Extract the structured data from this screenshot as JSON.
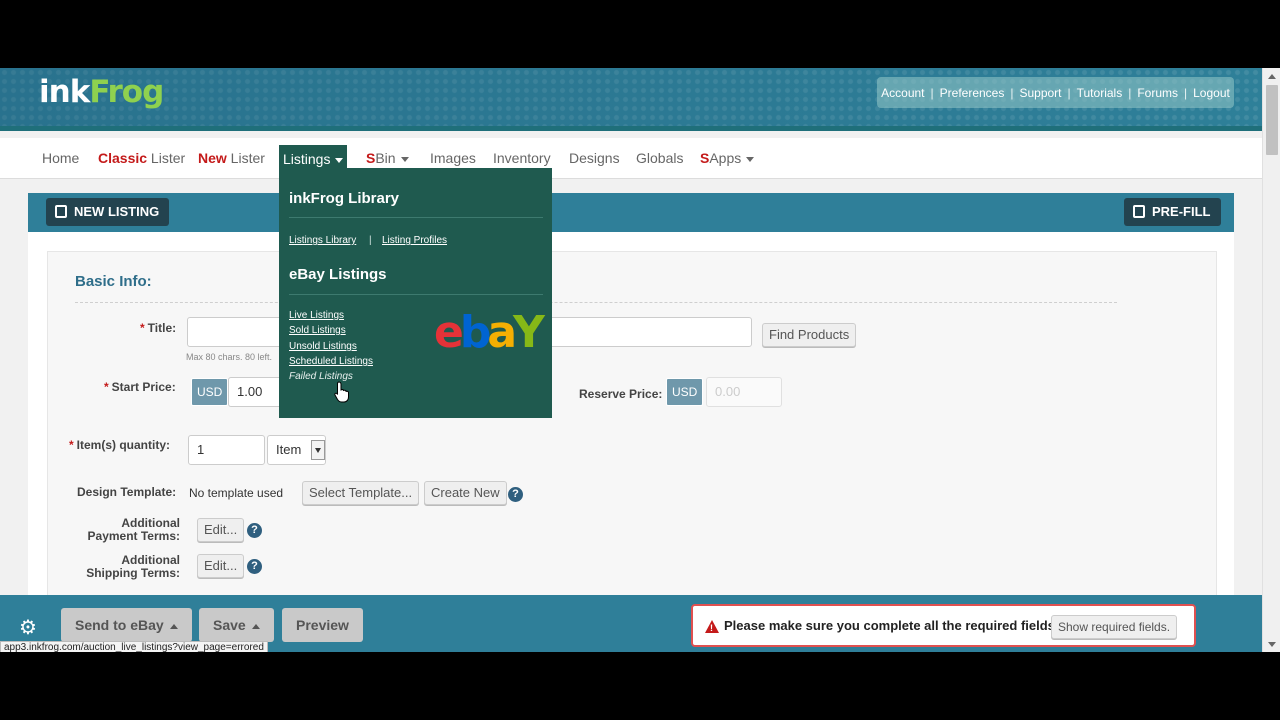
{
  "brand": {
    "logo_ink": "ink",
    "logo_frog": "Frog"
  },
  "account_links": [
    "Account",
    "Preferences",
    "Support",
    "Tutorials",
    "Forums",
    "Logout"
  ],
  "nav": {
    "home": "Home",
    "classic_red": "Classic",
    "classic_rest": " Lister",
    "new_red": "New",
    "new_rest": " Lister",
    "listings": "Listings",
    "sbin_red": "S",
    "sbin_rest": "Bin",
    "images": "Images",
    "inventory": "Inventory",
    "designs": "Designs",
    "globals": "Globals",
    "sapps_red": "S",
    "sapps_rest": "Apps"
  },
  "dropdown": {
    "library_title": "inkFrog Library",
    "listings_library": "Listings Library",
    "separator": "|",
    "listing_profiles": "Listing Profiles",
    "ebay_title": "eBay Listings",
    "live": "Live Listings",
    "sold": "Sold Listings",
    "unsold": "Unsold Listings",
    "scheduled": "Scheduled Listings",
    "failed": "Failed Listings"
  },
  "panel": {
    "new_listing": "NEW LISTING",
    "prefill": "PRE-FILL"
  },
  "form": {
    "section_title": "Basic Info:",
    "title_label": "Title:",
    "title_hint": "Max 80 chars. 80 left.",
    "find_products": "Find Products",
    "start_price_label": "Start Price:",
    "currency": "USD",
    "start_price_value": "1.00",
    "reserve_price_label": "Reserve Price:",
    "reserve_price_placeholder": "0.00",
    "quantity_label": "Item(s) quantity:",
    "quantity_value": "1",
    "quantity_unit": "Item",
    "design_template_label": "Design Template:",
    "design_template_value": "No template used",
    "select_template": "Select Template...",
    "create_new": "Create New",
    "payment_terms_label_1": "Additional",
    "payment_terms_label_2": "Payment Terms:",
    "shipping_terms_label_1": "Additional",
    "shipping_terms_label_2": "Shipping Terms:",
    "edit": "Edit...",
    "help": "?"
  },
  "bottom": {
    "send_to_ebay": "Send to eBay",
    "save": "Save",
    "preview": "Preview",
    "alert_message": "Please make sure you complete all the required fields",
    "show_required": "Show required fields.",
    "status_url": "app3.inkfrog.com/auction_live_listings?view_page=errored"
  },
  "colors": {
    "teal": "#2f7f99",
    "dropdown_bg": "#1f5a4f",
    "red": "#c41a1a",
    "dark_button": "#23434f"
  }
}
